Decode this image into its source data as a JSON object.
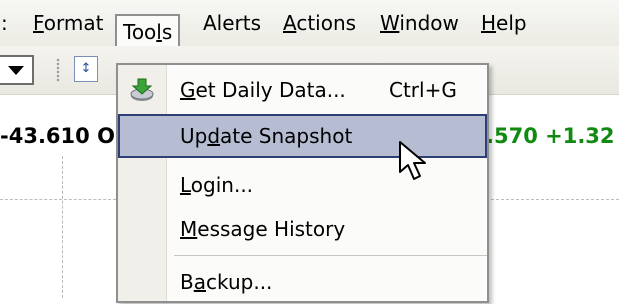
{
  "menubar": {
    "items": [
      {
        "label": ":",
        "underline": ""
      },
      {
        "pre": "",
        "u": "F",
        "post": "ormat"
      },
      {
        "pre": "Too",
        "u": "l",
        "post": "s"
      },
      {
        "pre": "Alerts",
        "u": "",
        "post": ""
      },
      {
        "pre": "",
        "u": "A",
        "post": "ctions"
      },
      {
        "pre": "",
        "u": "W",
        "post": "indow"
      },
      {
        "pre": "",
        "u": "H",
        "post": "elp"
      }
    ]
  },
  "toolbar": {
    "icon_text": "↕"
  },
  "data_row": {
    "left_text": "-43.610 O",
    "right_text": ".570  +1.32"
  },
  "tools_menu": {
    "items": [
      {
        "pre": "",
        "u": "G",
        "post": "et Daily Data...",
        "shortcut": "Ctrl+G",
        "icon": "download-icon"
      },
      {
        "pre": "Up",
        "u": "d",
        "post": "ate Snapshot",
        "shortcut": ""
      },
      {
        "pre": "",
        "u": "L",
        "post": "ogin...",
        "shortcut": ""
      },
      {
        "pre": "",
        "u": "M",
        "post": "essage History",
        "shortcut": ""
      },
      {
        "pre": "B",
        "u": "a",
        "post": "ckup...",
        "shortcut": ""
      }
    ]
  },
  "colors": {
    "highlight_bg": "#b6bdd2",
    "highlight_border": "#2f3e73",
    "positive_value": "#118a11"
  }
}
